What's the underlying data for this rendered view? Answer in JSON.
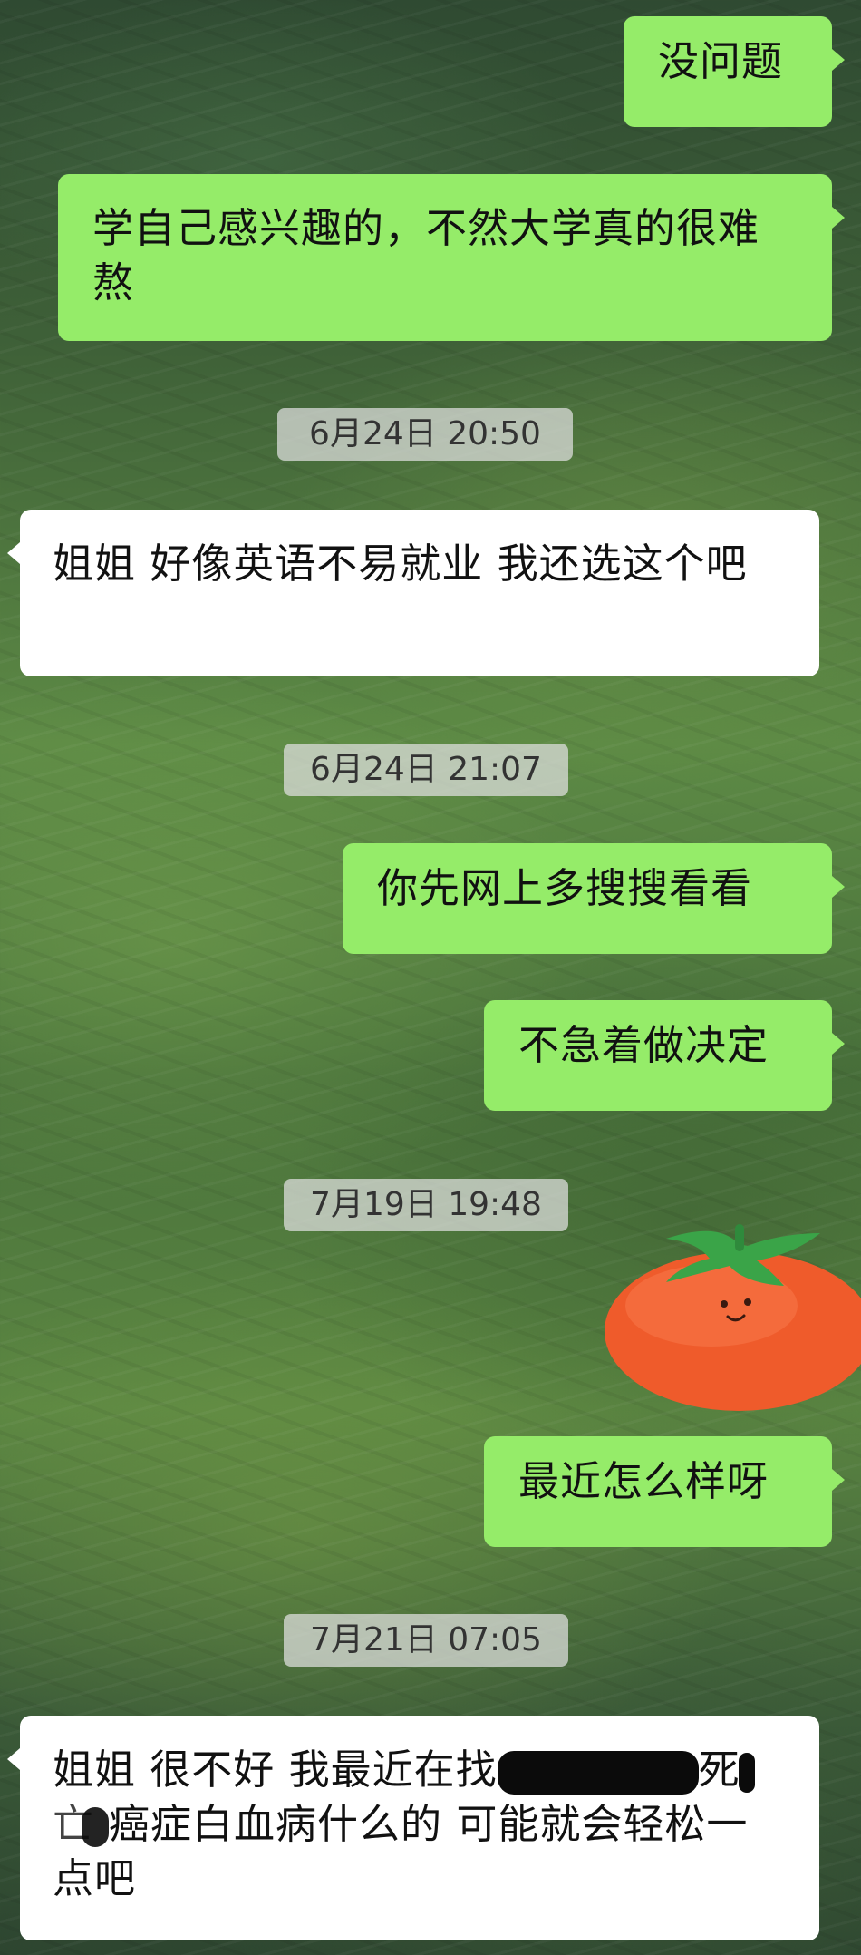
{
  "chat": {
    "msg1": "没问题",
    "msg2": "学自己感兴趣的，不然大学真的很难熬",
    "ts1": "6月24日 20:50",
    "msg3": "姐姐 好像英语不易就业 我还选这个吧",
    "ts2": "6月24日 21:07",
    "msg4": "你先网上多搜搜看看",
    "msg5": "不急着做决定",
    "ts3": "7月19日 19:48",
    "sticker": "tomato-sticker",
    "msg6": "最近怎么样呀",
    "ts4": "7月21日 07:05",
    "msg7": {
      "part1": "姐姐 很不好 我最近在找",
      "part2": "死",
      "part3": "亡",
      "part4": "癌症白血病什么的 可能就会轻松一点吧"
    }
  },
  "colors": {
    "outgoing_bubble": "#95ec69",
    "incoming_bubble": "#ffffff",
    "timestamp_bg": "#e1e1e1",
    "redaction": "#0b0b0b"
  }
}
